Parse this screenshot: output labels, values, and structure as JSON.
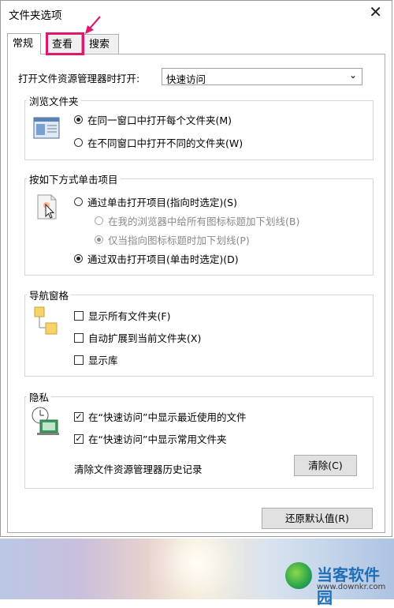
{
  "window": {
    "title": "文件夹选项",
    "close_glyph": "✕"
  },
  "tabs": [
    {
      "label": "常规"
    },
    {
      "label": "查看"
    },
    {
      "label": "搜索"
    }
  ],
  "general": {
    "open_label": "打开文件资源管理器时打开:",
    "open_value": "快速访问",
    "browse": {
      "title": "浏览文件夹",
      "options": [
        {
          "label": "在同一窗口中打开每个文件夹(M)",
          "selected": true
        },
        {
          "label": "在不同窗口中打开不同的文件夹(W)",
          "selected": false
        }
      ]
    },
    "click": {
      "title": "按如下方式单击项目",
      "single": "通过单击打开项目(指向时选定)(S)",
      "sub1": "在我的浏览器中给所有图标标题加下划线(B)",
      "sub2": "仅当指向图标标题时加下划线(P)",
      "double": "通过双击打开项目(单击时选定)(D)"
    },
    "nav": {
      "title": "导航窗格",
      "show_all": "显示所有文件夹(F)",
      "expand": "自动扩展到当前文件夹(X)",
      "libraries": "显示库"
    },
    "privacy": {
      "title": "隐私",
      "recent_files": "在“快速访问”中显示最近使用的文件",
      "frequent_folders": "在“快速访问”中显示常用文件夹",
      "clear_label": "清除文件资源管理器历史记录",
      "clear_button": "清除(C)"
    },
    "restore_button": "还原默认值(R)"
  },
  "watermark": {
    "name": "当客软件园",
    "url": "www.downkr.com"
  },
  "colors": {
    "highlight": "#e0186c",
    "watermark_text": "#1f6fb7"
  }
}
